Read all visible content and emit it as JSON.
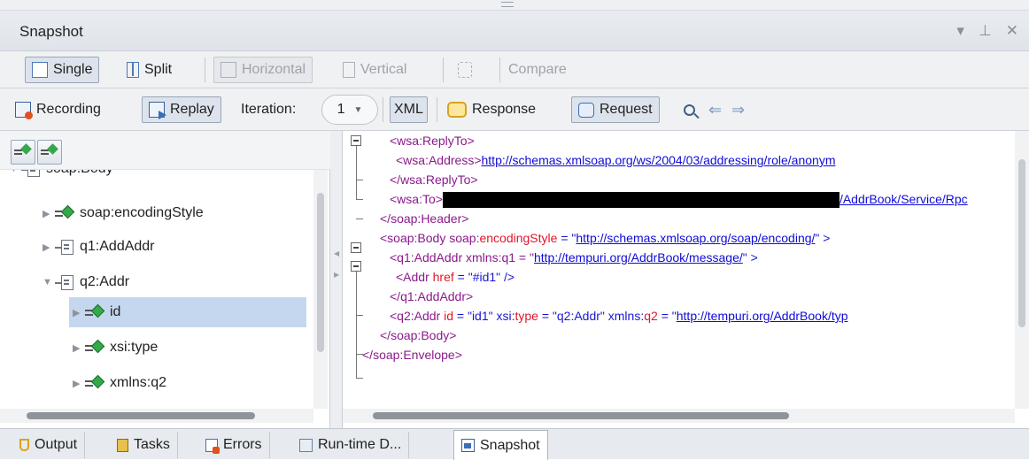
{
  "panel": {
    "title": "Snapshot",
    "controls": {
      "menu": "▾",
      "pin": "ꟷ",
      "close": "✕"
    }
  },
  "view_toolbar": {
    "single": "Single",
    "split": "Split",
    "horizontal": "Horizontal",
    "vertical": "Vertical",
    "compare": "Compare"
  },
  "snapshot_toolbar": {
    "recording": "Recording",
    "replay": "Replay",
    "iteration_label": "Iteration:",
    "iteration_value": "1",
    "xml": "XML",
    "response": "Response",
    "request": "Request"
  },
  "tree": {
    "partial_row": "soap:Body",
    "items": [
      {
        "label": "soap:encodingStyle",
        "kind": "attribute"
      },
      {
        "label": "q1:AddAddr",
        "kind": "element"
      },
      {
        "label": "q2:Addr",
        "kind": "element",
        "expanded": true
      },
      {
        "label": "id",
        "kind": "attribute",
        "selected": true
      },
      {
        "label": "xsi:type",
        "kind": "attribute"
      },
      {
        "label": "xmlns:q2",
        "kind": "attribute"
      }
    ]
  },
  "xml": {
    "l1_tag": "<wsa:ReplyTo>",
    "l2_open": "<wsa:Address>",
    "l2_link": "http://schemas.xmlsoap.org/ws/2004/03/addressing/role/anonym",
    "l3_tag": "</wsa:ReplyTo>",
    "l4_open": "<wsa:To>",
    "l4_link": "/AddrBook/Service/Rpc",
    "l5_tag": "</soap:Header>",
    "l6_open": "<soap:Body soap:",
    "l6_attr": "encodingStyle",
    "l6_eq": " = \"",
    "l6_link": "http://schemas.xmlsoap.org/soap/encoding/",
    "l6_close": "\" >",
    "l7_open": "<q1:AddAddr xmlns:q1 = \"",
    "l7_link": "http://tempuri.org/AddrBook/message/",
    "l7_close": "\" >",
    "l8_open": "<Addr ",
    "l8_attr": "href",
    "l8_val": " = \"#id1\" />",
    "l9_tag": "</q1:AddAddr>",
    "l10_open": "<q2:Addr ",
    "l10_attr1": "id",
    "l10_v1": " = \"id1\" xsi:",
    "l10_attr2": "type",
    "l10_v2": " = \"q2:Addr\" xmlns:",
    "l10_attr3": "q2",
    "l10_v3": " = \"",
    "l10_link": "http://tempuri.org/AddrBook/typ",
    "l11_tag": "</soap:Body>",
    "l12_tag": "</soap:Envelope>"
  },
  "tabs": [
    {
      "label": "Output"
    },
    {
      "label": "Tasks"
    },
    {
      "label": "Errors"
    },
    {
      "label": "Run-time D..."
    },
    {
      "label": "Snapshot",
      "active": true
    }
  ],
  "colors": {
    "selection": "#c5d7ee",
    "tag": "#8a1a8c",
    "attribute": "#e0162b",
    "link": "#0f0bd6"
  }
}
